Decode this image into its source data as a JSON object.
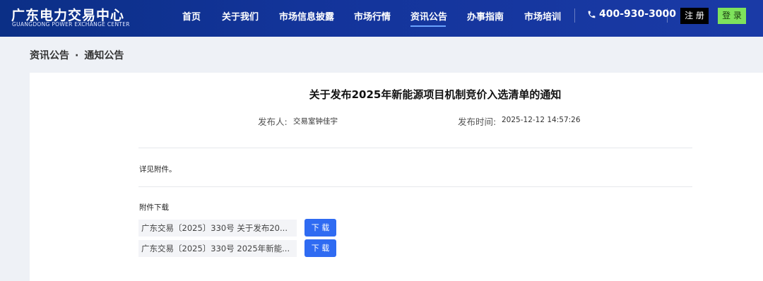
{
  "brand": {
    "name_cn": "广东电力交易中心",
    "name_en": "GUANGDONG POWER EXCHANGE CENTER"
  },
  "nav": {
    "items": [
      {
        "label": "首页"
      },
      {
        "label": "关于我们"
      },
      {
        "label": "市场信息披露"
      },
      {
        "label": "市场行情"
      },
      {
        "label": "资讯公告",
        "active": true
      },
      {
        "label": "办事指南"
      },
      {
        "label": "市场培训"
      }
    ],
    "active_color": "#6aa3ff"
  },
  "header": {
    "phone": "400-930-3000",
    "phone_icon": "phone-icon",
    "register_label": "注 册",
    "login_label": "登 录"
  },
  "breadcrumb": {
    "section": "资讯公告",
    "separator": "·",
    "current": "通知公告"
  },
  "article": {
    "title": "关于发布2025年新能源项目机制竞价入选清单的通知",
    "publisher_label": "发布人:",
    "publisher": "交易室钟佳宇",
    "time_label": "发布时间:",
    "time": "2025-12-12 14:57:26",
    "body": "详见附件。",
    "attachments_title": "附件下载",
    "attachments": [
      {
        "name": "广东交易〔2025〕330号 关于发布20...",
        "button": "下 载"
      },
      {
        "name": "广东交易〔2025〕330号 2025年新能...",
        "button": "下 载"
      }
    ]
  },
  "colors": {
    "header_bg": "#13349a",
    "download_button": "#2f6bf2",
    "login_button": "#7ee25c",
    "register_button": "#000000"
  }
}
